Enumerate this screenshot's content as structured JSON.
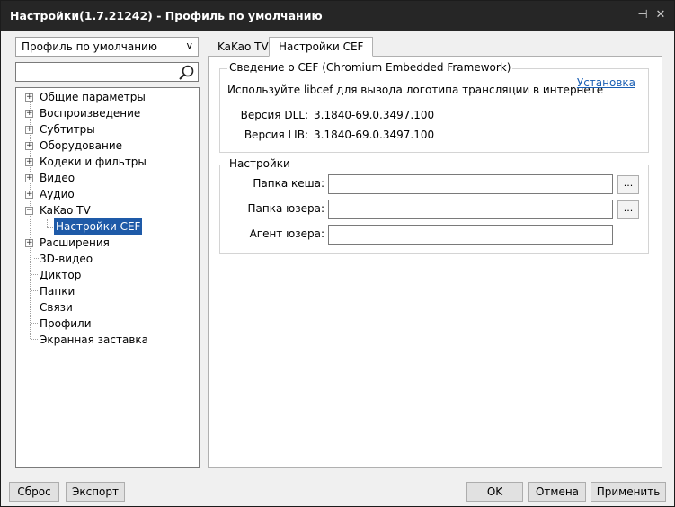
{
  "window": {
    "title": "Настройки(1.7.21242) - Профиль по умолчанию",
    "pin_glyph": "⊣",
    "close_glyph": "✕"
  },
  "sidebar": {
    "profile_select": {
      "value": "Профиль по умолчанию",
      "arrow": "v"
    },
    "search": {
      "value": "",
      "placeholder": ""
    },
    "tree": [
      {
        "label": "Общие параметры",
        "expander": "+"
      },
      {
        "label": "Воспроизведение",
        "expander": "+"
      },
      {
        "label": "Субтитры",
        "expander": "+"
      },
      {
        "label": "Оборудование",
        "expander": "+"
      },
      {
        "label": "Кодеки и фильтры",
        "expander": "+"
      },
      {
        "label": "Видео",
        "expander": "+"
      },
      {
        "label": "Аудио",
        "expander": "+"
      },
      {
        "label": "KaKao TV",
        "expander": "−"
      },
      {
        "label": "Настройки CEF",
        "expander": ""
      },
      {
        "label": "Расширения",
        "expander": "+"
      },
      {
        "label": "3D-видео",
        "expander": ""
      },
      {
        "label": "Диктор",
        "expander": ""
      },
      {
        "label": "Папки",
        "expander": ""
      },
      {
        "label": "Связи",
        "expander": ""
      },
      {
        "label": "Профили",
        "expander": ""
      },
      {
        "label": "Экранная заставка",
        "expander": ""
      }
    ]
  },
  "tabs": [
    {
      "label": "KaKao TV",
      "active": false
    },
    {
      "label": "Настройки CEF",
      "active": true
    }
  ],
  "cef_group": {
    "title": "Сведение о CEF (Chromium Embedded Framework)",
    "description": "Используйте libcef для вывода логотипа трансляции в интернете",
    "install_link": "Установка",
    "dll_label": "Версия DLL:",
    "dll_value": "3.1840-69.0.3497.100",
    "lib_label": "Версия LIB:",
    "lib_value": "3.1840-69.0.3497.100"
  },
  "settings_group": {
    "title": "Настройки",
    "cache_label": "Папка кеша:",
    "cache_value": "",
    "user_label": "Папка юзера:",
    "user_value": "",
    "agent_label": "Агент юзера:",
    "agent_value": "",
    "browse_label": "..."
  },
  "footer": {
    "reset": "Сброс",
    "export": "Экспорт",
    "ok": "OK",
    "cancel": "Отмена",
    "apply": "Применить"
  }
}
